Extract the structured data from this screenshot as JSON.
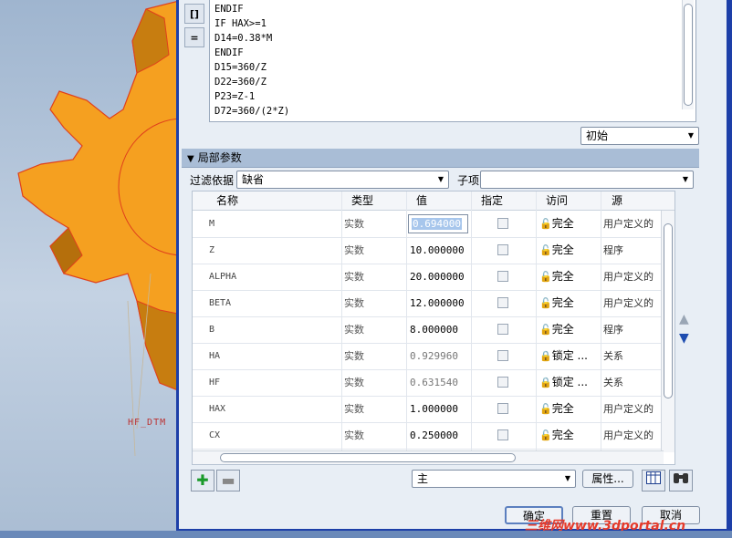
{
  "relations_code": [
    "ENDIF",
    "IF HAX>=1",
    "D14=0.38*M",
    "ENDIF",
    "D15=360/Z",
    "D22=360/Z",
    "P23=Z-1",
    "D72=360/(2*Z)"
  ],
  "side_buttons": [
    "[]",
    "="
  ],
  "initial_combo": "初始",
  "local_section": {
    "title": "局部参数"
  },
  "filter": {
    "label": "过滤依据",
    "value": "缺省",
    "subitem_label": "子项",
    "subitem_value": ""
  },
  "table": {
    "columns": [
      "名称",
      "类型",
      "值",
      "指定",
      "访问",
      "源"
    ],
    "rows": [
      {
        "name": "M",
        "type": "实数",
        "value": "0.694000",
        "access": "完全",
        "source": "用户定义的",
        "dim": false,
        "selected": true
      },
      {
        "name": "Z",
        "type": "实数",
        "value": "10.000000",
        "access": "完全",
        "source": "程序",
        "dim": false
      },
      {
        "name": "ALPHA",
        "type": "实数",
        "value": "20.000000",
        "access": "完全",
        "source": "用户定义的",
        "dim": false
      },
      {
        "name": "BETA",
        "type": "实数",
        "value": "12.000000",
        "access": "完全",
        "source": "用户定义的",
        "dim": false
      },
      {
        "name": "B",
        "type": "实数",
        "value": "8.000000",
        "access": "完全",
        "source": "程序",
        "dim": false
      },
      {
        "name": "HA",
        "type": "实数",
        "value": "0.929960",
        "access": "锁定 ...",
        "source": "关系",
        "dim": true
      },
      {
        "name": "HF",
        "type": "实数",
        "value": "0.631540",
        "access": "锁定 ...",
        "source": "关系",
        "dim": true
      },
      {
        "name": "HAX",
        "type": "实数",
        "value": "1.000000",
        "access": "完全",
        "source": "用户定义的",
        "dim": false
      },
      {
        "name": "CX",
        "type": "实数",
        "value": "0.250000",
        "access": "完全",
        "source": "用户定义的",
        "dim": false
      }
    ]
  },
  "scope_combo": "主",
  "properties_button": "属性...",
  "ok_button": "确定",
  "reset_button": "重置",
  "cancel_button": "取消",
  "datum_label": "HF_DTM",
  "watermark": "三维网www.3dportal.cn",
  "colors": {
    "gear": "#f5a020",
    "gear_edge": "#e0401c",
    "dialog_frame": "#1d3fa8"
  }
}
